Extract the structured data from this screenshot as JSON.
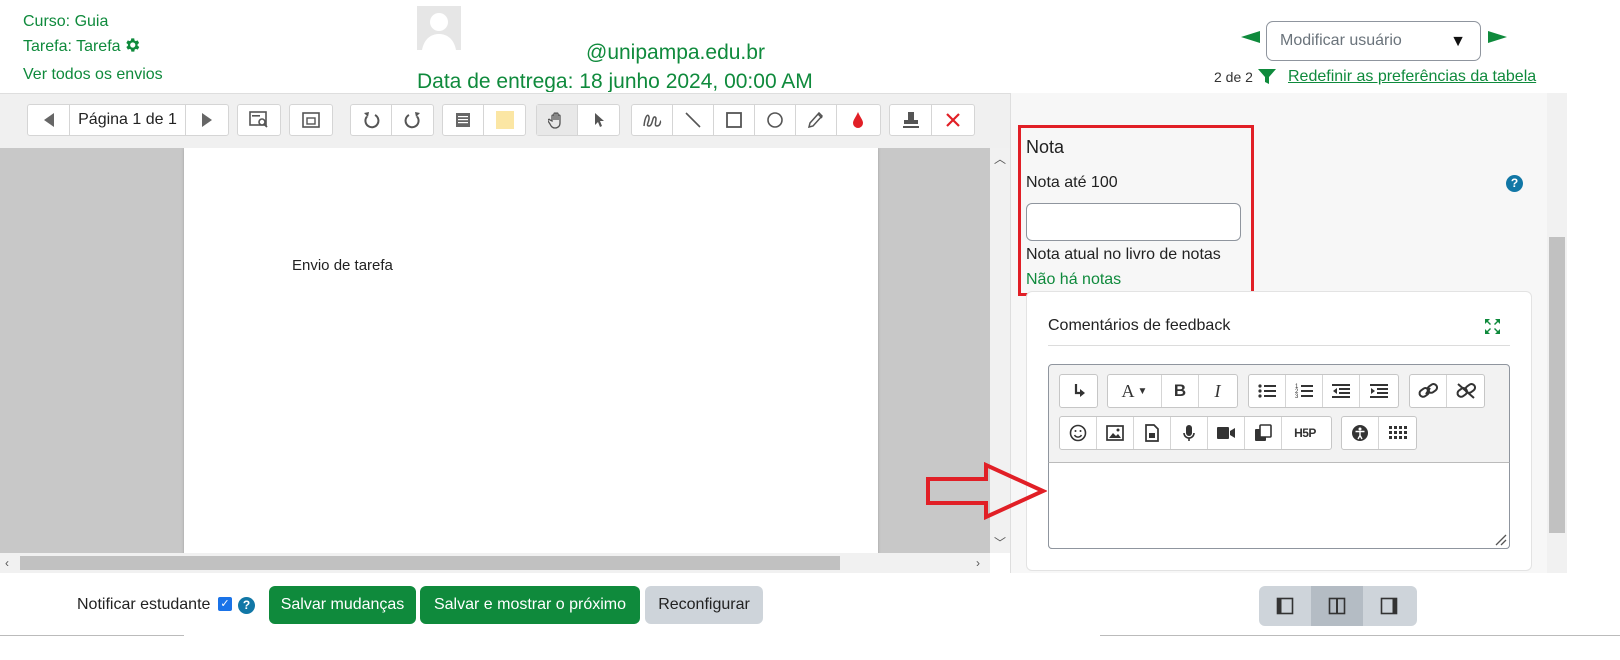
{
  "header": {
    "course": "Curso: Guia",
    "task": "Tarefa: Tarefa",
    "view_all": "Ver todos os envios",
    "email": "@unipampa.edu.br",
    "due_date": "Data de entrega: 18 junho 2024, 00:00 AM",
    "user_select_placeholder": "Modificar usuário",
    "count": "2 de 2",
    "reset_prefs": "Redefinir as preferências da tabela"
  },
  "viewer": {
    "page_label": "Página 1 de 1",
    "document_text": "Envio de tarefa"
  },
  "grade": {
    "title": "Nota",
    "label": "Nota até 100",
    "input_value": "",
    "current_label": "Nota atual no livro de notas",
    "current_value": "Não há notas"
  },
  "feedback": {
    "title": "Comentários de feedback",
    "text": ""
  },
  "footer": {
    "notify_label": "Notificar estudante",
    "notify_checked": true,
    "save_label": "Salvar mudanças",
    "save_next_label": "Salvar e mostrar o próximo",
    "reset_label": "Reconfigurar"
  },
  "colors": {
    "brand_green": "#0f8a3c",
    "highlight_red": "#e11f26",
    "help_blue": "#1177a6"
  }
}
